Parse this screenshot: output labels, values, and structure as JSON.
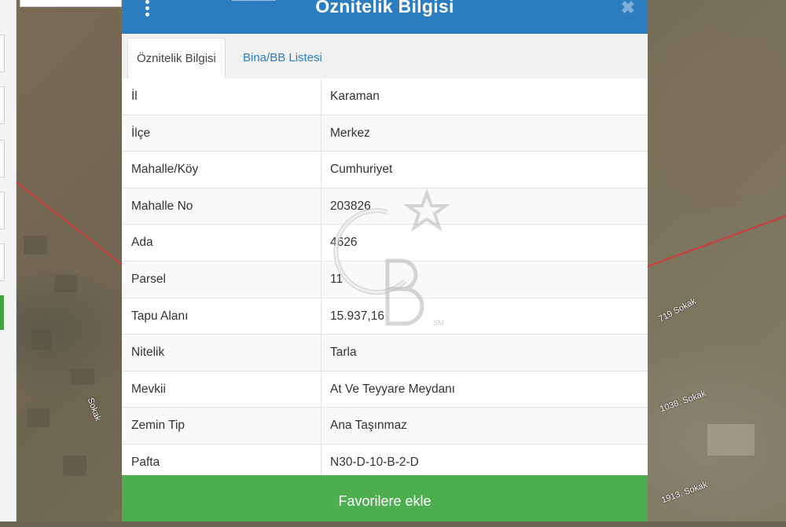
{
  "modal": {
    "title": "Öznitelik Bilgisi",
    "close_symbol": "✖",
    "tabs": [
      {
        "label": "Öznitelik Bilgisi",
        "active": true
      },
      {
        "label": "Bina/BB Listesi",
        "active": false
      }
    ],
    "rows": [
      {
        "label": "İl",
        "value": "Karaman"
      },
      {
        "label": "İlçe",
        "value": "Merkez"
      },
      {
        "label": "Mahalle/Köy",
        "value": "Cumhuriyet"
      },
      {
        "label": "Mahalle No",
        "value": "203826"
      },
      {
        "label": "Ada",
        "value": "4626"
      },
      {
        "label": "Parsel",
        "value": "11"
      },
      {
        "label": "Tapu Alanı",
        "value": "15.937,16"
      },
      {
        "label": "Nitelik",
        "value": "Tarla"
      },
      {
        "label": "Mevkii",
        "value": "At Ve Teyyare Meydanı"
      },
      {
        "label": "Zemin Tip",
        "value": "Ana Taşınmaz"
      },
      {
        "label": "Pafta",
        "value": "N30-D-10-B-2-D"
      }
    ],
    "favorite_button": "Favorilere ekle"
  },
  "map": {
    "street_labels": [
      "719 Sokak",
      "1038. Sokak",
      "1913. Sokak",
      "Sokak"
    ]
  },
  "watermark": {
    "text": "GB",
    "mark": "SM"
  },
  "colors": {
    "header": "#2c7dbf",
    "favorite_button": "#4cae4f",
    "tab_link": "#2c7dbf"
  }
}
